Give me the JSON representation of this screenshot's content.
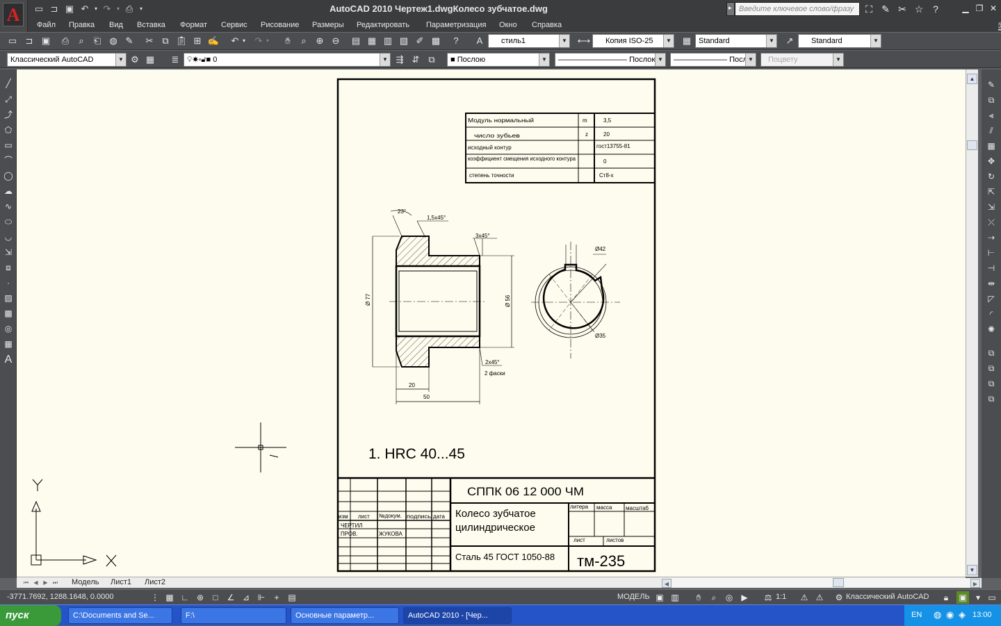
{
  "window": {
    "title": "AutoCAD 2010    Чертеж1.dwgКолесо зубчатое.dwg",
    "search_placeholder": "Введите ключевое слово/фразу"
  },
  "menu": [
    "Файл",
    "Правка",
    "Вид",
    "Вставка",
    "Формат",
    "Сервис",
    "Рисование",
    "Размеры",
    "Редактировать",
    "Параметризация",
    "Окно",
    "Справка"
  ],
  "toolbar": {
    "text_style": "стиль1",
    "dim_style": "Копия ISO-25",
    "table_style": "Standard",
    "mleader_style": "Standard",
    "workspace": "Классический AutoCAD",
    "layer": "0",
    "color": "Послою",
    "linetype": "Послою",
    "lineweight": "Послою",
    "plotstyle": "Поцвету"
  },
  "tabs": [
    "Модель",
    "Лист1",
    "Лист2"
  ],
  "status": {
    "coordinates": "-3771.7692, 1288.1648, 0.0000",
    "model": "МОДЕЛЬ",
    "scale": "1:1",
    "workspace": "Классический AutoCAD"
  },
  "taskbar": {
    "start": "пуск",
    "items": [
      "C:\\Documents and Se...",
      "F:\\",
      "Основные параметр...",
      "AutoCAD 2010 - [Чер..."
    ],
    "lang": "EN",
    "time": "13:00"
  },
  "drawing": {
    "params_table": [
      [
        "Модуль нормальный",
        "m",
        "3,5"
      ],
      [
        "число зубьев",
        "z",
        "20"
      ],
      [
        "исходный контур",
        "",
        "гост13755-81"
      ],
      [
        "коэффициент смещения исходного контура",
        "",
        "0"
      ],
      [
        "степень точности",
        "",
        "Ст8-х"
      ]
    ],
    "dims": {
      "angle": "23°",
      "chamfer1": "1,5х45°",
      "chamfer2": "3х45°",
      "d77": "Ø 77",
      "d56": "Ø 56",
      "chamfer3": "2х45°",
      "chamfer3_note": "2 фаски",
      "len20": "20",
      "len50": "50",
      "d42": "Ø42",
      "d35": "Ø35"
    },
    "note": "1. HRC 40...45",
    "title_block": {
      "code": "СППК 06 12 000 ЧМ",
      "name_line1": "Колесо зубчатое",
      "name_line2": "цилиндрическое",
      "material": "Сталь 45 ГОСТ 1050-88",
      "group": "тм-235",
      "col_izm": "изм",
      "col_list": "лист",
      "col_ndoc": "№докум.",
      "col_podp": "подпись",
      "col_data": "дата",
      "row_chertil": "ЧЕРТИЛ",
      "row_prov": "ПРОВ.",
      "surname": "ЖУКОВА",
      "litera": "литера",
      "massa": "масса",
      "masshtab": "масштаб",
      "list": "лист",
      "listov": "листов"
    },
    "ucs_x": "X",
    "ucs_y": "Y"
  }
}
